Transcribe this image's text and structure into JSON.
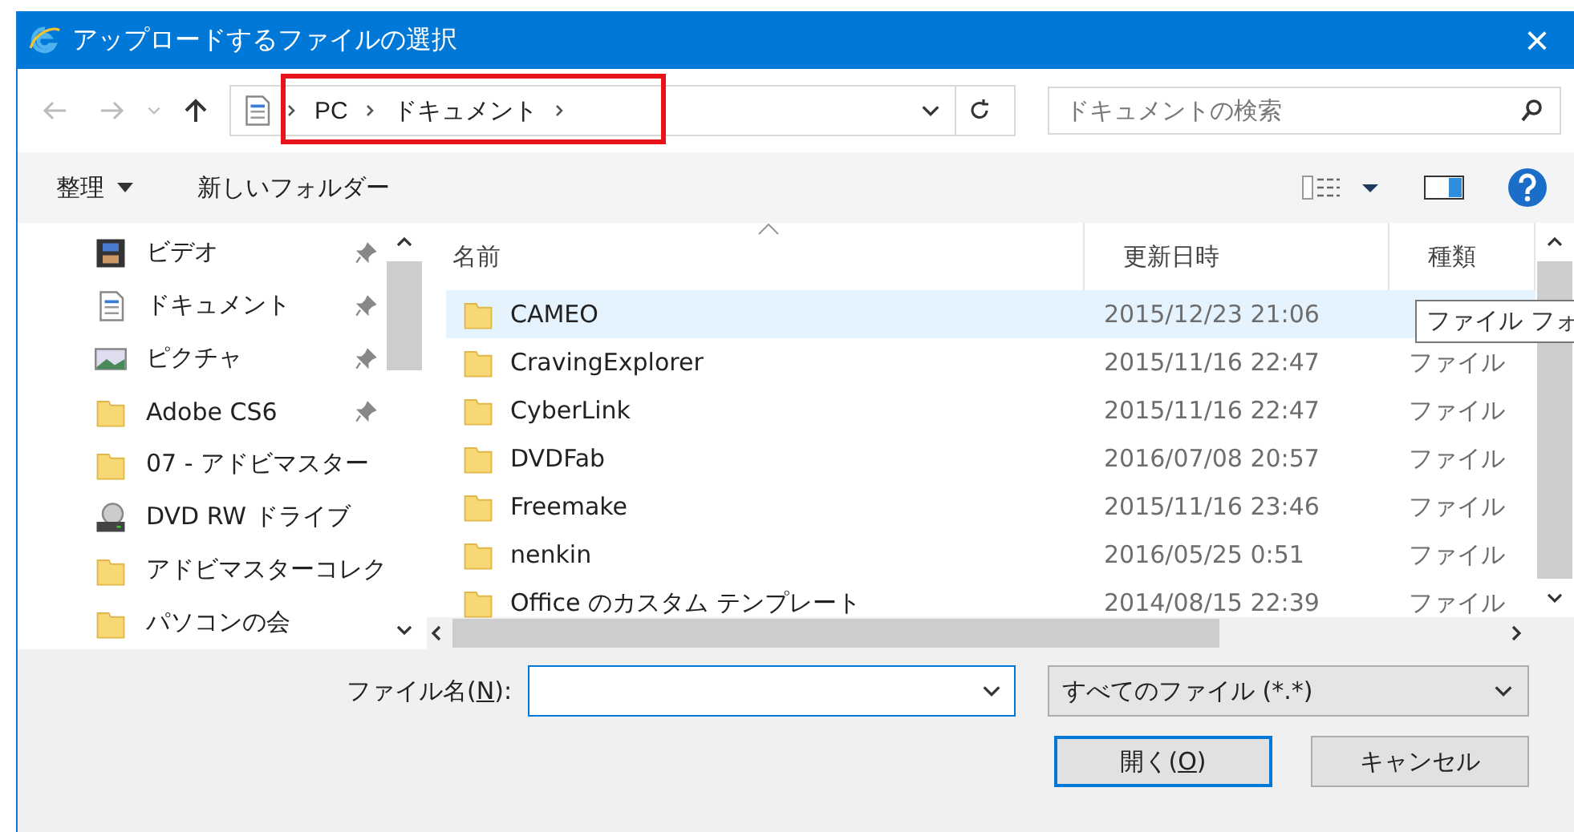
{
  "window": {
    "title": "アップロードするファイルの選択",
    "close": "×"
  },
  "address": {
    "breadcrumb": [
      "PC",
      "ドキュメント"
    ],
    "highlighted": true
  },
  "search": {
    "placeholder": "ドキュメントの検索"
  },
  "toolbar": {
    "organize": "整理",
    "new_folder": "新しいフォルダー"
  },
  "sidebar": {
    "items": [
      {
        "label": "ビデオ",
        "kind": "video",
        "pinned": true
      },
      {
        "label": "ドキュメント",
        "kind": "document",
        "pinned": true
      },
      {
        "label": "ピクチャ",
        "kind": "picture",
        "pinned": true
      },
      {
        "label": "Adobe CS6",
        "kind": "folder",
        "pinned": true
      },
      {
        "label": "07 - アドビマスター",
        "kind": "folder",
        "pinned": false
      },
      {
        "label": "DVD RW ドライブ",
        "kind": "drive",
        "pinned": false
      },
      {
        "label": "アドビマスターコレク",
        "kind": "folder",
        "pinned": false
      },
      {
        "label": "パソコンの会",
        "kind": "folder",
        "pinned": false
      }
    ]
  },
  "table": {
    "columns": [
      "名前",
      "更新日時",
      "種類"
    ],
    "rows": [
      {
        "name": "CAMEO",
        "date": "2015/12/23 21:06",
        "selected": true
      },
      {
        "name": "CravingExplorer",
        "date": "2015/11/16 22:47",
        "type": "ファイル",
        "selected": false
      },
      {
        "name": "CyberLink",
        "date": "2015/11/16 22:47",
        "type": "ファイル",
        "selected": false
      },
      {
        "name": "DVDFab",
        "date": "2016/07/08 20:57",
        "type": "ファイル",
        "selected": false
      },
      {
        "name": "Freemake",
        "date": "2015/11/16 23:46",
        "type": "ファイル",
        "selected": false
      },
      {
        "name": "nenkin",
        "date": "2016/05/25 0:51",
        "type": "ファイル",
        "selected": false
      },
      {
        "name": "Office のカスタム テンプレート",
        "date": "2014/08/15 22:39",
        "type": "ファイル",
        "selected": false
      }
    ]
  },
  "tooltip": "ファイル フォ",
  "filename": {
    "label_before": "ファイル名(",
    "mnemonic": "N",
    "label_after": "):"
  },
  "filter": {
    "value": "すべてのファイル (*.*)"
  },
  "buttons": [
    {
      "before": "開く(",
      "mnemonic": "O",
      "after": ")",
      "default": true
    },
    {
      "before": "キャンセル",
      "default": false
    }
  ]
}
